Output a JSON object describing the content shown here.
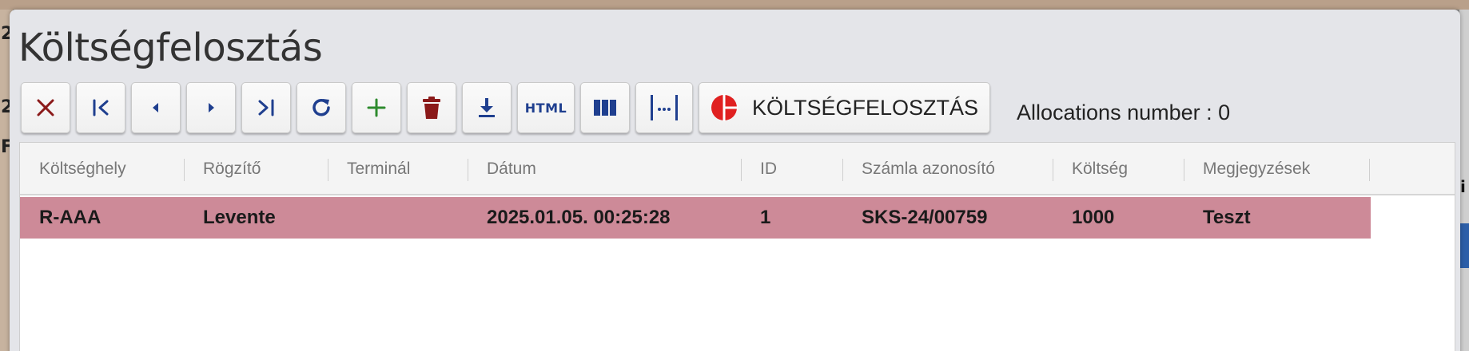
{
  "dialog": {
    "title": "Költségfelosztás"
  },
  "toolbar": {
    "buttons": [
      {
        "name": "close",
        "icon": "close-icon",
        "color": "#8b1a1a"
      },
      {
        "name": "first",
        "icon": "first-page-icon",
        "color": "#1f3f8f"
      },
      {
        "name": "prev",
        "icon": "previous-icon",
        "color": "#1f3f8f"
      },
      {
        "name": "next",
        "icon": "next-icon",
        "color": "#1f3f8f"
      },
      {
        "name": "last",
        "icon": "last-page-icon",
        "color": "#1f3f8f"
      },
      {
        "name": "refresh",
        "icon": "refresh-icon",
        "color": "#1f3f8f"
      },
      {
        "name": "add",
        "icon": "plus-icon",
        "color": "#2e8b2e"
      },
      {
        "name": "delete",
        "icon": "trash-icon",
        "color": "#8b1a1a"
      },
      {
        "name": "download",
        "icon": "download-icon",
        "color": "#1f3f8f"
      },
      {
        "name": "html",
        "icon": "html-icon",
        "label": "HTML",
        "color": "#1f3f8f"
      },
      {
        "name": "columns",
        "icon": "columns-icon",
        "color": "#1f3f8f"
      },
      {
        "name": "fit-width",
        "icon": "fit-width-icon",
        "color": "#1f3f8f"
      }
    ],
    "report_label": "KÖLTSÉGFELOSZTÁS",
    "report_icon": "pie-chart-icon",
    "report_icon_color": "#e02020"
  },
  "status": {
    "allocations_text": "Allocations number : 0"
  },
  "table": {
    "columns": [
      "Költséghely",
      "Rögzítő",
      "Terminál",
      "Dátum",
      "ID",
      "Számla azonosító",
      "Költség",
      "Megjegyzések"
    ],
    "rows": [
      {
        "selected": true,
        "cells": [
          "R-AAA",
          "Levente",
          "",
          "2025.01.05. 00:25:28",
          "1",
          "SKS-24/00759",
          "1000",
          "Teszt"
        ]
      }
    ],
    "selected_row_color": "#cd8a98"
  }
}
